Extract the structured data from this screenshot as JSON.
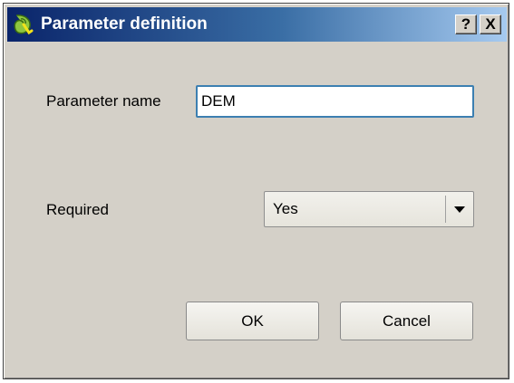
{
  "window": {
    "title": "Parameter definition",
    "app_icon": "qgis-logo-icon",
    "help_label": "?",
    "close_label": "X",
    "colors": {
      "titlebar_start": "#0a246a",
      "titlebar_end": "#a6caf0",
      "dialog_bg": "#d4d0c8",
      "input_focus_border": "#3c7fb1"
    }
  },
  "form": {
    "parameter_name": {
      "label": "Parameter name",
      "value": "DEM"
    },
    "required": {
      "label": "Required",
      "selected": "Yes"
    }
  },
  "buttons": {
    "ok": "OK",
    "cancel": "Cancel"
  }
}
